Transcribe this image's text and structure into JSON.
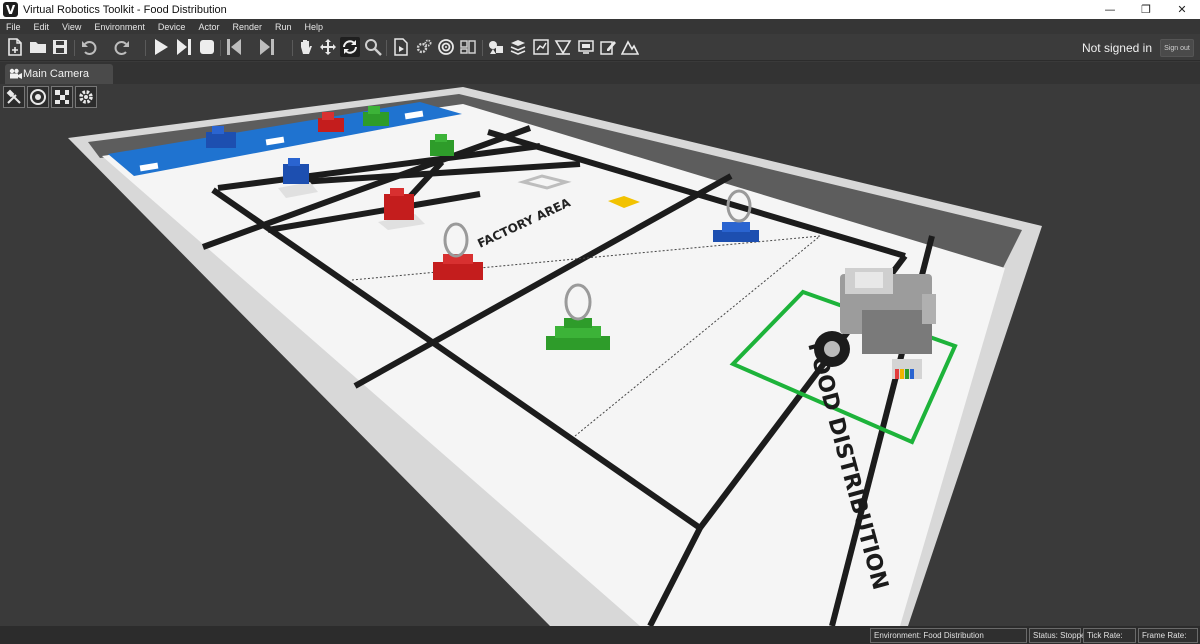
{
  "window": {
    "title": "Virtual Robotics Toolkit - Food Distribution",
    "logo_letter": "V",
    "minimize": "—",
    "maximize": "❐",
    "close": "✕"
  },
  "menu": {
    "items": [
      "File",
      "Edit",
      "View",
      "Environment",
      "Device",
      "Actor",
      "Render",
      "Run",
      "Help"
    ]
  },
  "toolbar": {
    "account_status": "Not signed in",
    "signout_label": "Sign out",
    "icons": [
      "new-file-icon",
      "open-folder-icon",
      "save-icon",
      "undo-icon",
      "redo-icon",
      "play-icon",
      "step-forward-icon",
      "stop-icon",
      "skip-back-icon",
      "skip-forward-icon",
      "hand-pan-icon",
      "move-icon",
      "rotate-icon",
      "zoom-icon",
      "load-file-icon",
      "settings-gears-icon",
      "target-icon",
      "sensor-icon",
      "model-icon",
      "layers-icon",
      "chart-icon",
      "measure-icon",
      "screenshot-icon",
      "edit-icon",
      "terrain-icon"
    ]
  },
  "camera_tab": {
    "label": "Main Camera"
  },
  "viewport": {
    "tools": [
      "tools-icon",
      "wheel-icon",
      "checker-icon",
      "gear-icon"
    ],
    "field_label": "FACTORY AREA",
    "zone_label": "FOOD DISTRIBUTION",
    "zone_color": "#1db33a",
    "lego_colors": {
      "blue": "#1d4fb0",
      "red": "#c41d1d",
      "green": "#2e9c2a",
      "yellow": "#f2c200"
    }
  },
  "status": {
    "environment": "Environment: Food Distribution",
    "state": "Status: Stopped",
    "tick_rate": "Tick Rate:",
    "frame_rate": "Frame Rate:"
  }
}
